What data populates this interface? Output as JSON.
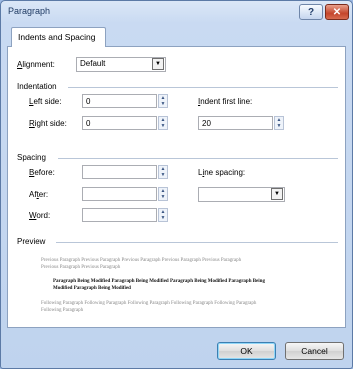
{
  "window": {
    "title": "Paragraph",
    "help_symbol": "?",
    "close_symbol": "✕"
  },
  "tabs": [
    {
      "label": "Indents and Spacing",
      "selected": true
    }
  ],
  "alignment": {
    "label_u": "A",
    "label_rest": "lignment:",
    "value": "Default"
  },
  "indentation": {
    "heading": "Indentation",
    "left": {
      "label_u": "L",
      "label_rest": "eft side:",
      "value": "0"
    },
    "right": {
      "label_u": "R",
      "label_rest": "ight side:",
      "value": "0"
    },
    "first_line": {
      "label_u": "I",
      "label_rest": "ndent first line:",
      "value": "20"
    }
  },
  "spacing": {
    "heading": "Spacing",
    "before": {
      "label_u": "B",
      "label_rest": "efore:",
      "value": ""
    },
    "after": {
      "label_pre": "Af",
      "label_u": "t",
      "label_rest": "er:",
      "value": ""
    },
    "word": {
      "label_u": "W",
      "label_rest": "ord:",
      "value": ""
    },
    "line_spacing": {
      "label_pre": "L",
      "label_u": "i",
      "label_rest": "ne spacing:",
      "value": ""
    }
  },
  "preview": {
    "heading": "Preview",
    "previous_1": "Previous Paragraph Previous Paragraph Previous Paragraph Previous Paragraph Previous Paragraph",
    "previous_2": "Previous Paragraph Previous Paragraph",
    "modified_1": "Paragraph Being Modified Paragraph Being Modified Paragraph Being Modified Paragraph Being",
    "modified_2": "Modified Paragraph Being Modified",
    "following_1": "Following Paragraph Following Paragraph Following Paragraph Following Paragraph Following Paragraph",
    "following_2": "Following Paragraph"
  },
  "buttons": {
    "ok": "OK",
    "cancel": "Cancel"
  },
  "icons": {
    "spin_up": "▲",
    "spin_down": "▼",
    "dropdown": "▼"
  },
  "colors": {
    "title_bar": "#c9daf2",
    "accent": "#3c7fb1",
    "close": "#c4452b"
  }
}
